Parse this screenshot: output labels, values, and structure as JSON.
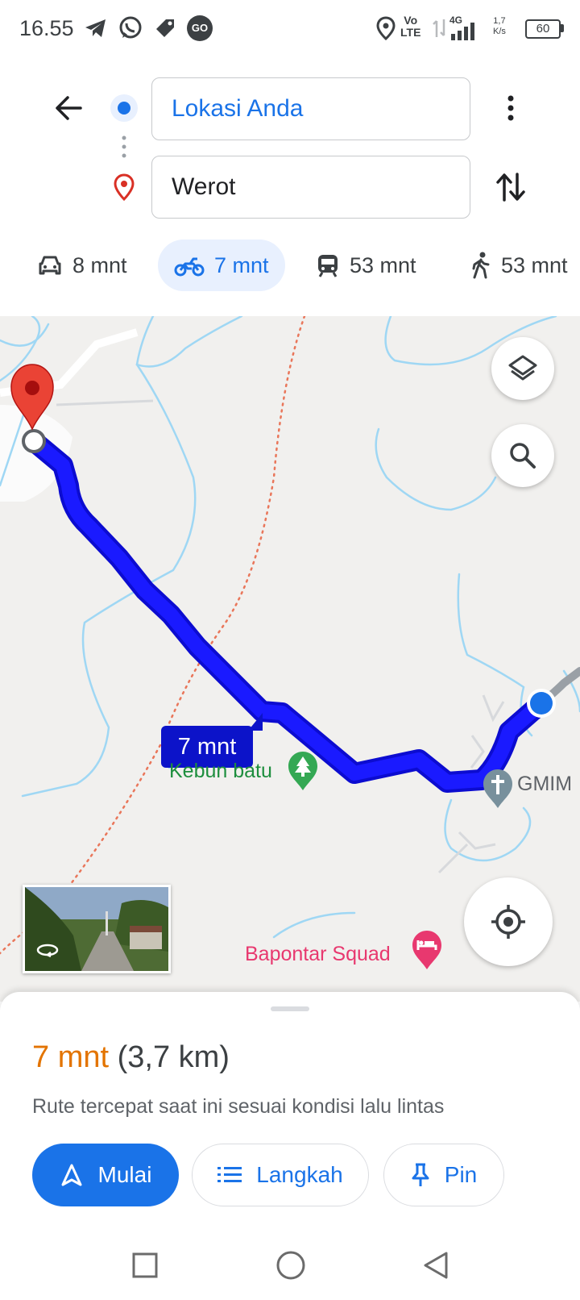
{
  "status_bar": {
    "time": "16.55",
    "battery": "60",
    "net_speed_value": "1,7",
    "net_speed_unit": "K/s",
    "network": "4G",
    "volte_top": "Vo",
    "volte_bottom": "LTE",
    "app_icons": [
      "telegram-icon",
      "whatsapp-icon",
      "tag-icon",
      "gojek-icon"
    ],
    "gojek_label": "GO"
  },
  "header": {
    "origin": "Lokasi Anda",
    "destination": "Werot"
  },
  "modes": [
    {
      "icon": "car-icon",
      "label": "8 mnt",
      "active": false
    },
    {
      "icon": "motorcycle-icon",
      "label": "7 mnt",
      "active": true
    },
    {
      "icon": "transit-icon",
      "label": "53 mnt",
      "active": false
    },
    {
      "icon": "walk-icon",
      "label": "53 mnt",
      "active": false
    }
  ],
  "map": {
    "route_badge": "7 mnt",
    "places": {
      "kebun": "Kebun batu",
      "gmim": "GMIM",
      "bapontar": "Bapontar Squad"
    },
    "colors": {
      "route": "#1a1aff",
      "route_outline": "#0c0cd0",
      "water": "#9fd7f4",
      "boundary": "#e9765a",
      "park": "#34a853",
      "pin": "#ea4335",
      "lodging": "#e8386f"
    }
  },
  "sheet": {
    "duration": "7 mnt",
    "distance": "(3,7 km)",
    "description": "Rute tercepat saat ini sesuai kondisi lalu lintas",
    "buttons": {
      "start": "Mulai",
      "steps": "Langkah",
      "pin": "Pin"
    }
  }
}
